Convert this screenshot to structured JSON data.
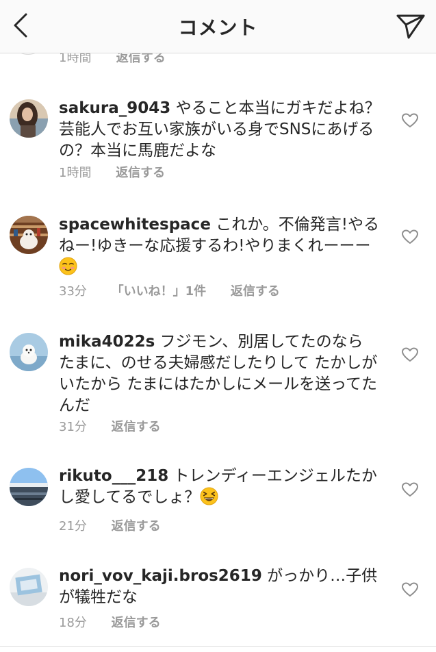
{
  "header": {
    "title": "コメント",
    "back_icon": "chevron-left-icon",
    "send_icon": "paper-plane-icon"
  },
  "partial_comment": {
    "time": "1時間",
    "reply": "返信する"
  },
  "comments": [
    {
      "username": "sakura_9043",
      "text": " やること本当にガキだよね？芸能人でお互い家族がいる身でSNSにあげるの？本当に馬鹿だよな",
      "time": "1時間",
      "likes": "",
      "reply": "返信する",
      "avatar_colors": [
        "#6b5a4a",
        "#cdb79e"
      ]
    },
    {
      "username": "spacewhitespace",
      "text": " これか。不倫発言!やるねー!ゆきーな応援するわ!やりまくれーーー",
      "emoji": "relieved-face-emoji",
      "time": "33分",
      "likes": "「いいね！」1件",
      "reply": "返信する",
      "avatar_colors": [
        "#7a4a2a",
        "#c9a27a"
      ]
    },
    {
      "username": "mika4022s",
      "text": " フジモン、別居してたのなら たまに、のせる夫婦感だしたりして たかしがいたから たまにはたかしにメールを送ってたんだ",
      "time": "31分",
      "likes": "",
      "reply": "返信する",
      "avatar_colors": [
        "#9fc3dd",
        "#f2f2f2"
      ]
    },
    {
      "username": "rikuto___218",
      "text": " トレンディーエンジェルたかし愛してるでしょ？",
      "emoji": "grinning-squinting-face-emoji",
      "time": "21分",
      "likes": "",
      "reply": "返信する",
      "avatar_colors": [
        "#7fb4e6",
        "#3c4a5a"
      ]
    },
    {
      "username": "nori_vov_kaji.bros2619",
      "text": " がっかり…子供が犠牲だな",
      "time": "18分",
      "likes": "",
      "reply": "返信する",
      "avatar_colors": [
        "#e9eef2",
        "#8fb7d6"
      ]
    }
  ]
}
